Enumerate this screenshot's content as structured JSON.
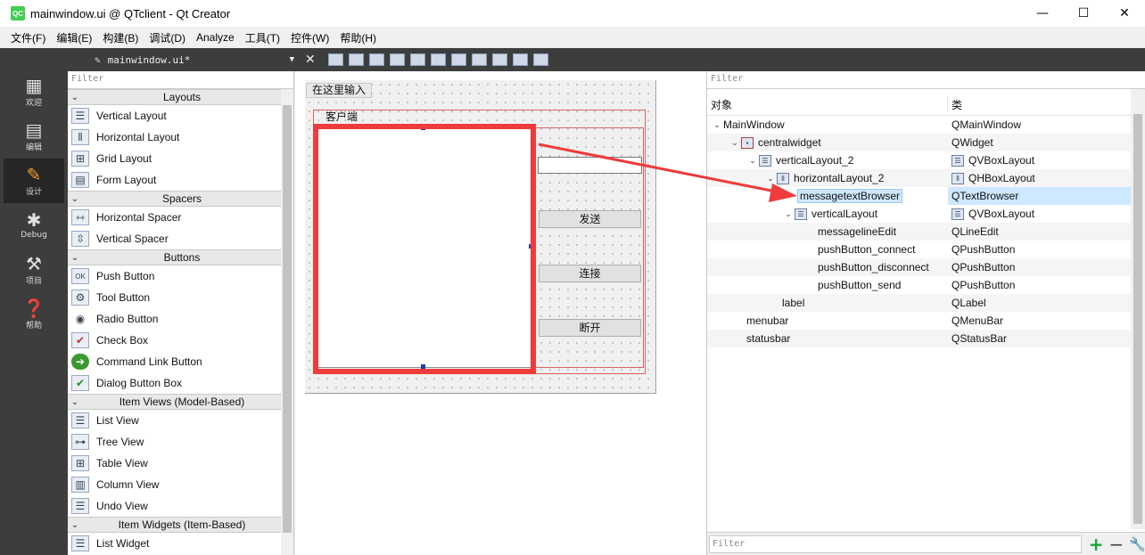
{
  "window": {
    "app_icon": "QC",
    "title": "mainwindow.ui @ QTclient - Qt Creator",
    "controls": {
      "minimize": "—",
      "maximize": "☐",
      "close": "✕"
    }
  },
  "menu": {
    "items": [
      "文件(F)",
      "编辑(E)",
      "构建(B)",
      "调试(D)",
      "Analyze",
      "工具(T)",
      "控件(W)",
      "帮助(H)"
    ]
  },
  "modes": [
    {
      "label": "欢迎",
      "icon": "grid-icon"
    },
    {
      "label": "编辑",
      "icon": "document-icon"
    },
    {
      "label": "设计",
      "icon": "pencil-icon"
    },
    {
      "label": "Debug",
      "icon": "bug-icon"
    },
    {
      "label": "项目",
      "icon": "wrench-icon"
    },
    {
      "label": "帮助",
      "icon": "help-icon"
    }
  ],
  "editor_toolbar": {
    "file_name": "mainwindow.ui*"
  },
  "widget_box": {
    "filter_placeholder": "Filter",
    "categories": [
      {
        "name": "Layouts",
        "items": [
          "Vertical Layout",
          "Horizontal Layout",
          "Grid Layout",
          "Form Layout"
        ]
      },
      {
        "name": "Spacers",
        "items": [
          "Horizontal Spacer",
          "Vertical Spacer"
        ]
      },
      {
        "name": "Buttons",
        "items": [
          "Push Button",
          "Tool Button",
          "Radio Button",
          "Check Box",
          "Command Link Button",
          "Dialog Button Box"
        ]
      },
      {
        "name": "Item Views (Model-Based)",
        "items": [
          "List View",
          "Tree View",
          "Table View",
          "Column View",
          "Undo View"
        ]
      },
      {
        "name": "Item Widgets (Item-Based)",
        "items": [
          "List Widget"
        ]
      }
    ]
  },
  "form": {
    "menubar_placeholder": "在这里输入",
    "group_label": "客户端",
    "buttons": {
      "send": "发送",
      "connect": "连接",
      "disconnect": "断开"
    }
  },
  "inspector": {
    "filter_placeholder": "Filter",
    "header": {
      "object": "对象",
      "class": "类"
    },
    "rows": [
      {
        "name": "MainWindow",
        "class": "QMainWindow"
      },
      {
        "name": "centralwidget",
        "class": "QWidget"
      },
      {
        "name": "verticalLayout_2",
        "class": "QVBoxLayout"
      },
      {
        "name": "horizontalLayout_2",
        "class": "QHBoxLayout"
      },
      {
        "name": "messagetextBrowser",
        "class": "QTextBrowser"
      },
      {
        "name": "verticalLayout",
        "class": "QVBoxLayout"
      },
      {
        "name": "messagelineEdit",
        "class": "QLineEdit"
      },
      {
        "name": "pushButton_connect",
        "class": "QPushButton"
      },
      {
        "name": "pushButton_disconnect",
        "class": "QPushButton"
      },
      {
        "name": "pushButton_send",
        "class": "QPushButton"
      },
      {
        "name": "label",
        "class": "QLabel"
      },
      {
        "name": "menubar",
        "class": "QMenuBar"
      },
      {
        "name": "statusbar",
        "class": "QStatusBar"
      }
    ],
    "bottom_filter_placeholder": "Filter"
  },
  "colors": {
    "highlight": "#ef3b3b",
    "selection": "#cde8ff"
  }
}
